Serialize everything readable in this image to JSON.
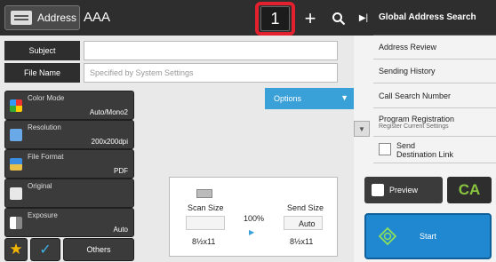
{
  "header": {
    "address_label": "Address",
    "address_value": "AAA",
    "destination_count": "1",
    "plus_label": "+"
  },
  "fields": {
    "subject_label": "Subject",
    "subject_value": "",
    "file_name_label": "File Name",
    "file_name_placeholder": "Specified by System Settings"
  },
  "settings": [
    {
      "label": "Color Mode",
      "value": "Auto/Mono2"
    },
    {
      "label": "Resolution",
      "value": "200x200dpi"
    },
    {
      "label": "File Format",
      "value": "PDF"
    },
    {
      "label": "Original",
      "value": ""
    },
    {
      "label": "Exposure",
      "value": "Auto"
    }
  ],
  "options_label": "Options",
  "scan": {
    "scan_size_label": "Scan Size",
    "send_size_label": "Send Size",
    "ratio": "100%",
    "send_size_mode": "Auto",
    "scan_paper": "8½x11",
    "send_paper": "8½x11"
  },
  "bottom": {
    "others_label": "Others"
  },
  "right_panel": {
    "title": "Global Address Search",
    "items": [
      {
        "label": "Address Review",
        "sub": ""
      },
      {
        "label": "Sending History",
        "sub": ""
      },
      {
        "label": "Call Search Number",
        "sub": ""
      },
      {
        "label": "Program Registration",
        "sub": "Register Current Settings"
      },
      {
        "label": "Send",
        "sub": "Destination Link"
      }
    ]
  },
  "actions": {
    "preview_label": "Preview",
    "ca_label": "CA",
    "start_label": "Start"
  },
  "colors": {
    "highlight": "#e2202e",
    "options_blue": "#3aa0d8",
    "start_blue": "#1f88d1",
    "ca_green": "#8ac53f",
    "star_yellow": "#f2b600"
  }
}
